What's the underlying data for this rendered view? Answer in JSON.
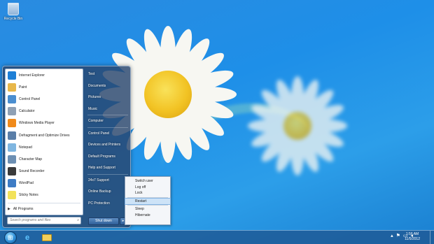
{
  "desktop": {
    "icons": [
      {
        "label": "Recycle Bin",
        "icon": "recycle-bin-icon"
      }
    ]
  },
  "start_menu": {
    "programs": [
      {
        "label": "Internet Explorer",
        "icon": "internet-explorer-icon",
        "color": "#1e7fd6"
      },
      {
        "label": "Paint",
        "icon": "paint-icon",
        "color": "#e8b74a"
      },
      {
        "label": "Control Panel",
        "icon": "control-panel-icon",
        "color": "#4a8ed0"
      },
      {
        "label": "Calculator",
        "icon": "calculator-icon",
        "color": "#8fa0b4"
      },
      {
        "label": "Windows Media Player",
        "icon": "media-player-icon",
        "color": "#f08a1a"
      },
      {
        "label": "Defragment and Optimize Drives",
        "icon": "defragment-icon",
        "color": "#5a7ea8"
      },
      {
        "label": "Notepad",
        "icon": "notepad-icon",
        "color": "#7fb6e0"
      },
      {
        "label": "Character Map",
        "icon": "character-map-icon",
        "color": "#6c8fb3"
      },
      {
        "label": "Sound Recorder",
        "icon": "sound-recorder-icon",
        "color": "#3a3a3a"
      },
      {
        "label": "WordPad",
        "icon": "wordpad-icon",
        "color": "#3d7bc4"
      },
      {
        "label": "Sticky Notes",
        "icon": "sticky-notes-icon",
        "color": "#f2e25a"
      }
    ],
    "all_programs": "All Programs",
    "search_placeholder": "Search programs and files",
    "places": [
      "Test",
      "Documents",
      "Pictures",
      "Music",
      "Computer",
      "Control Panel",
      "Devices and Printers",
      "Default Programs",
      "Help and Support",
      "24x7 Support",
      "Online Backup",
      "PC Protection"
    ],
    "shutdown_label": "Shut down",
    "shutdown_arrow": "▸"
  },
  "shutdown_flyout": {
    "items_top": [
      "Switch user",
      "Log off",
      "Lock"
    ],
    "items_mid": [
      "Restart"
    ],
    "items_bottom": [
      "Sleep",
      "Hibernate"
    ],
    "selected": "Restart"
  },
  "taskbar": {
    "pinned": [
      {
        "name": "internet-explorer",
        "icon": "internet-explorer-icon"
      },
      {
        "name": "file-explorer",
        "icon": "folder-icon"
      }
    ],
    "clock": {
      "time": "1:56 AM",
      "date": "11/5/2012"
    }
  }
}
